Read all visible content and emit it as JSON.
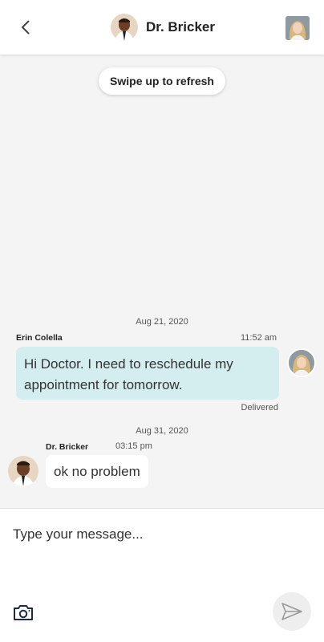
{
  "header": {
    "title": "Dr. Bricker",
    "back_icon": "chevron-left-icon",
    "doctor_avatar": "doctor-avatar",
    "user_avatar": "user-avatar"
  },
  "refresh": {
    "label": "Swipe up to refresh"
  },
  "messages": [
    {
      "date": "Aug 21, 2020",
      "sender": "Erin Colella",
      "time": "11:52 am",
      "text": "Hi Doctor. I need to reschedule my appointment for tomorrow.",
      "status": "Delivered"
    },
    {
      "date": "Aug 31, 2020",
      "sender": "Dr. Bricker",
      "time": "03:15 pm",
      "text": "ok no problem"
    }
  ],
  "composer": {
    "placeholder": "Type your message...",
    "camera_icon": "camera-icon",
    "send_icon": "send-icon"
  },
  "colors": {
    "outgoing_bubble": "#d4eef0",
    "background": "#f4f4f4"
  }
}
